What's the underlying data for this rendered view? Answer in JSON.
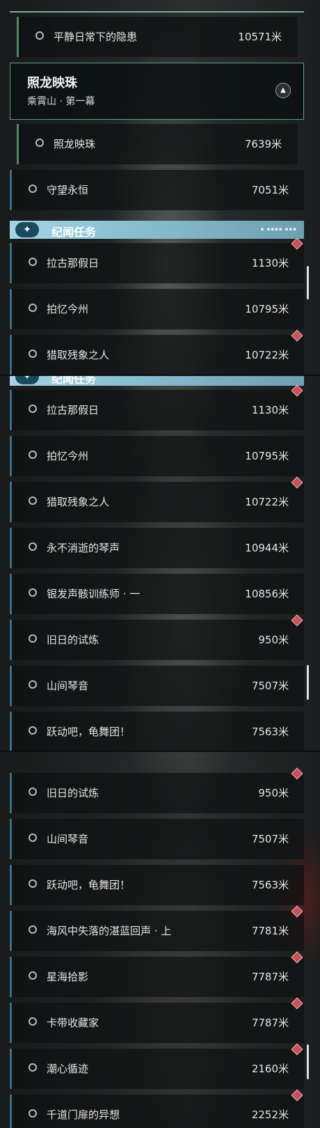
{
  "chapter": {
    "title": "照龙映珠",
    "subtitle": "乘霄山 · 第一幕",
    "collapse_icon": "collapse-up-icon"
  },
  "section": {
    "title": "纪闻任务",
    "icon": "star-icon"
  },
  "seg1": [
    {
      "title": "平静日常下的隐患",
      "dist": "10571米"
    }
  ],
  "seg1b": [
    {
      "title": "照龙映珠",
      "dist": "7639米"
    },
    {
      "title": "守望永恒",
      "dist": "7051米"
    }
  ],
  "seg1c": [
    {
      "title": "拉古那假日",
      "dist": "1130米"
    },
    {
      "title": "拍忆今州",
      "dist": "10795米"
    },
    {
      "title": "猎取残象之人",
      "dist": "10722米"
    }
  ],
  "seg2": [
    {
      "title": "拉古那假日",
      "dist": "1130米"
    },
    {
      "title": "拍忆今州",
      "dist": "10795米"
    },
    {
      "title": "猎取残象之人",
      "dist": "10722米"
    },
    {
      "title": "永不消逝的琴声",
      "dist": "10944米"
    },
    {
      "title": "银发声骸训练师 · 一",
      "dist": "10856米"
    },
    {
      "title": "旧日的试炼",
      "dist": "950米"
    },
    {
      "title": "山间琴音",
      "dist": "7507米"
    },
    {
      "title": "跃动吧，龟舞团！",
      "dist": "7563米"
    }
  ],
  "seg3": [
    {
      "title": "旧日的试炼",
      "dist": "950米"
    },
    {
      "title": "山间琴音",
      "dist": "7507米"
    },
    {
      "title": "跃动吧，龟舞团！",
      "dist": "7563米"
    },
    {
      "title": "海风中失落的湛蓝回声 · 上",
      "dist": "7781米"
    },
    {
      "title": "星海拾影",
      "dist": "7787米"
    },
    {
      "title": "卡带收藏家",
      "dist": "7787米"
    },
    {
      "title": "潮心循迹",
      "dist": "2160米"
    },
    {
      "title": "千道门扉的异想",
      "dist": "2252米"
    }
  ]
}
